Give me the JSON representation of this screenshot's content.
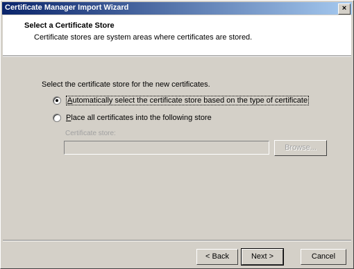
{
  "window": {
    "title": "Certificate Manager Import Wizard",
    "close_glyph": "×"
  },
  "header": {
    "title": "Select a Certificate Store",
    "description": "Certificate stores are system areas where certificates are stored."
  },
  "body": {
    "instruction": "Select the certificate store for the new certificates.",
    "options": [
      {
        "prefix": "",
        "accel": "A",
        "rest": "utomatically select the certificate store based on the type of certificate",
        "selected": true
      },
      {
        "prefix": "",
        "accel": "P",
        "rest": "lace all certificates into the following store",
        "selected": false
      }
    ],
    "store_label": "Certificate store:",
    "store_value": "",
    "browse_label": "Browse..."
  },
  "footer": {
    "back_label": "< Back",
    "next_label": "Next >",
    "cancel_label": "Cancel"
  }
}
